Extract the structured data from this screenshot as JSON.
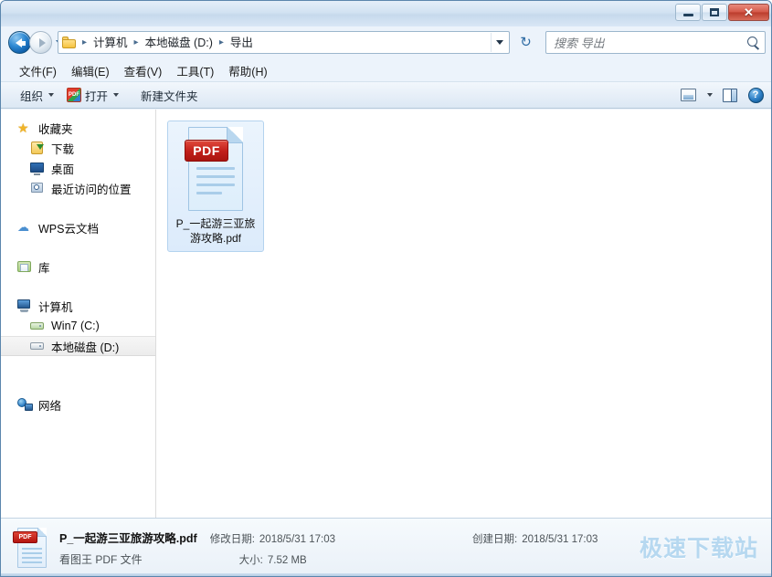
{
  "window": {
    "controls": {
      "minimize": "–",
      "maximize": "□",
      "close": "✕"
    }
  },
  "address": {
    "breadcrumbs": [
      "计算机",
      "本地磁盘 (D:)",
      "导出"
    ],
    "separator": "▸",
    "dropdown_icon": "chevron-down-icon",
    "refresh_icon": "↻"
  },
  "search": {
    "placeholder": "搜索 导出"
  },
  "menu": {
    "items": [
      {
        "label": "文件(F)"
      },
      {
        "label": "编辑(E)"
      },
      {
        "label": "查看(V)"
      },
      {
        "label": "工具(T)"
      },
      {
        "label": "帮助(H)"
      }
    ]
  },
  "toolbar": {
    "organize": "组织",
    "open": "打开",
    "new_folder": "新建文件夹",
    "help_glyph": "?"
  },
  "sidebar": {
    "groups": [
      {
        "header": {
          "label": "收藏夹",
          "icon": "star-icon"
        },
        "children": [
          {
            "label": "下载",
            "icon": "download-icon"
          },
          {
            "label": "桌面",
            "icon": "desktop-icon"
          },
          {
            "label": "最近访问的位置",
            "icon": "recent-places-icon"
          }
        ]
      },
      {
        "header": {
          "label": "WPS云文档",
          "icon": "cloud-icon"
        },
        "children": []
      },
      {
        "header": {
          "label": "库",
          "icon": "library-icon"
        },
        "children": []
      },
      {
        "header": {
          "label": "计算机",
          "icon": "computer-icon"
        },
        "children": [
          {
            "label": "Win7 (C:)",
            "icon": "hard-drive-icon",
            "selected": false
          },
          {
            "label": "本地磁盘 (D:)",
            "icon": "hard-drive-icon",
            "selected": true
          }
        ]
      },
      {
        "header": {
          "label": "网络",
          "icon": "network-icon"
        },
        "children": []
      }
    ]
  },
  "files": [
    {
      "name": "P_一起游三亚旅游攻略.pdf",
      "badge": "PDF",
      "selected": true
    }
  ],
  "status": {
    "file_name": "P_一起游三亚旅游攻略.pdf",
    "file_type": "看图王 PDF 文件",
    "badge": "PDF",
    "modified_label": "修改日期:",
    "modified_value": "2018/5/31 17:03",
    "created_label": "创建日期:",
    "created_value": "2018/5/31 17:03",
    "size_label": "大小:",
    "size_value": "7.52 MB"
  },
  "watermark": {
    "text": "极速下载站"
  },
  "colors": {
    "accent_blue": "#2f7fd2",
    "pdf_red": "#c2201a",
    "selection_fill": "#dcebfb",
    "selection_border": "#b4d3ef",
    "watermark": "#b6d8f0"
  }
}
